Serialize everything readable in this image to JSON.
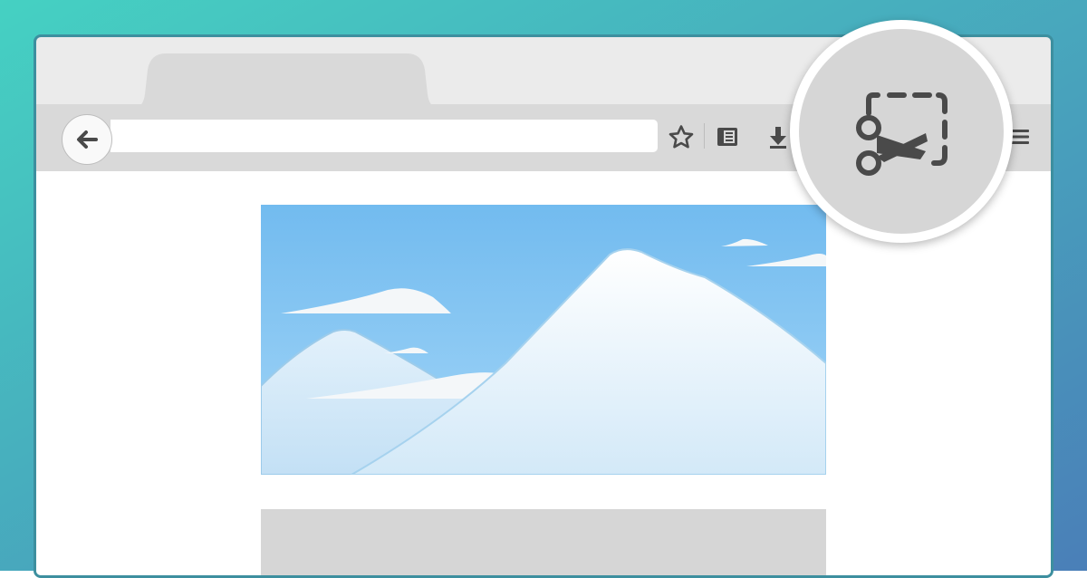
{
  "browser": {
    "tab": {
      "title": ""
    },
    "address_bar": {
      "value": ""
    },
    "toolbar": {
      "icons": [
        "back-arrow-icon",
        "bookmark-star-icon",
        "reader-list-icon",
        "download-icon",
        "screenshot-scissors-icon",
        "hamburger-menu-icon"
      ]
    }
  },
  "colors": {
    "background_gradient": [
      "#45d1c2",
      "#4a7fb8"
    ],
    "window_frame": "#ebebeb",
    "toolbar": "#d9d9d9",
    "icon": "#4a4a4a",
    "badge": "#d6d6d6",
    "sky": "#84c6f3",
    "snow": "#f4f9fd"
  }
}
